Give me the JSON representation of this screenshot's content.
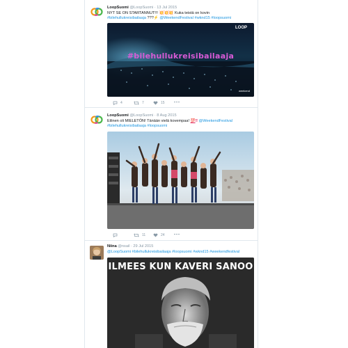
{
  "tweets": [
    {
      "name": "LoopSuomi",
      "handle": "@LoopSuomi",
      "date": "13 Jul 2015",
      "line1_text": "NYT SE ON STARTANNUT!!!",
      "line1_emoji": "💥💥💥",
      "line1_tail": "Kuka teistä on kovin",
      "line2_hashtag": "#bilehullukreisibailaaja",
      "line2_mid": "???",
      "line2_emoji": "⚡",
      "line2_links": "@WeekendFestival #wknd15 #loopsuomi",
      "image_overlay_text": "#bilehullukreisibailaaja",
      "image_corner_text": "LOOP",
      "image_watermark": "weekend",
      "actions": {
        "reply": "4",
        "retweet": "7",
        "like": "15"
      }
    },
    {
      "name": "LoopSuomi",
      "handle": "@LoopSuomi",
      "date": "8 Aug 2015",
      "line1_text": "Eilinen oli MIELETÖN! Tänään vielä kovempaa!",
      "line1_emoji": "💯",
      "line1_warn": "‼",
      "line1_links": "@WeekendFestival",
      "line2_links": "#bilehullukreisibailaaja #loopsuomi",
      "actions": {
        "reply": "",
        "retweet": "11",
        "like": "24"
      }
    },
    {
      "name": "Niina",
      "handle": "@nsail",
      "date": "29 Jul 2015",
      "line1_links": "@LoopSuomi #bilehullukreisibailaaja #loopsuomi #wknd15 #weekendfestival",
      "meme_caption": "ILMEES KUN KAVERI SANOO"
    }
  ],
  "colors": {
    "link": "#1b95e0",
    "meta": "#8899a6",
    "border": "#e1e8ed",
    "hashtag_overlay": "#d85ad6"
  },
  "icons": [
    "loop-logo-icon",
    "reply-icon",
    "retweet-icon",
    "like-icon",
    "more-icon"
  ]
}
